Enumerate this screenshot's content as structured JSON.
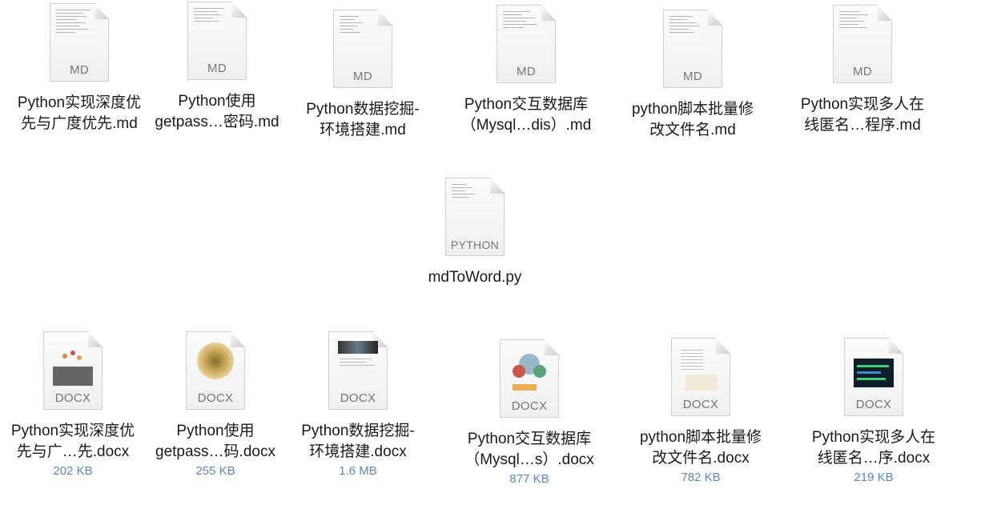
{
  "window": {
    "title": ""
  },
  "md_files": [
    {
      "name_line1": "Python实现深度优",
      "name_line2": "先与广度优先.md",
      "type": "MD"
    },
    {
      "name_line1": "Python使用",
      "name_line2": "getpass…密码.md",
      "type": "MD"
    },
    {
      "name_line1": "Python数据挖掘-",
      "name_line2": "环境搭建.md",
      "type": "MD"
    },
    {
      "name_line1": "Python交互数据库",
      "name_line2": "（Mysql…dis）.md",
      "type": "MD"
    },
    {
      "name_line1": "python脚本批量修",
      "name_line2": "改文件名.md",
      "type": "MD"
    },
    {
      "name_line1": "Python实现多人在",
      "name_line2": "线匿名…程序.md",
      "type": "MD"
    }
  ],
  "py_file": {
    "name": "mdToWord.py",
    "type": "PYTHON"
  },
  "docx_files": [
    {
      "name_line1": "Python实现深度优",
      "name_line2": "先与广…先.docx",
      "size": "202 KB",
      "type": "DOCX"
    },
    {
      "name_line1": "Python使用",
      "name_line2": "getpass…码.docx",
      "size": "255 KB",
      "type": "DOCX"
    },
    {
      "name_line1": "Python数据挖掘-",
      "name_line2": "环境搭建.docx",
      "size": "1.6 MB",
      "type": "DOCX"
    },
    {
      "name_line1": "Python交互数据库",
      "name_line2": "（Mysql…s）.docx",
      "size": "877 KB",
      "type": "DOCX"
    },
    {
      "name_line1": "python脚本批量修",
      "name_line2": "改文件名.docx",
      "size": "782 KB",
      "type": "DOCX"
    },
    {
      "name_line1": "Python实现多人在",
      "name_line2": "线匿名…序.docx",
      "size": "219 KB",
      "type": "DOCX"
    }
  ],
  "colors": {
    "size_text": "#5a86c8",
    "label_text": "#1a1a1a",
    "type_label": "#777777"
  }
}
